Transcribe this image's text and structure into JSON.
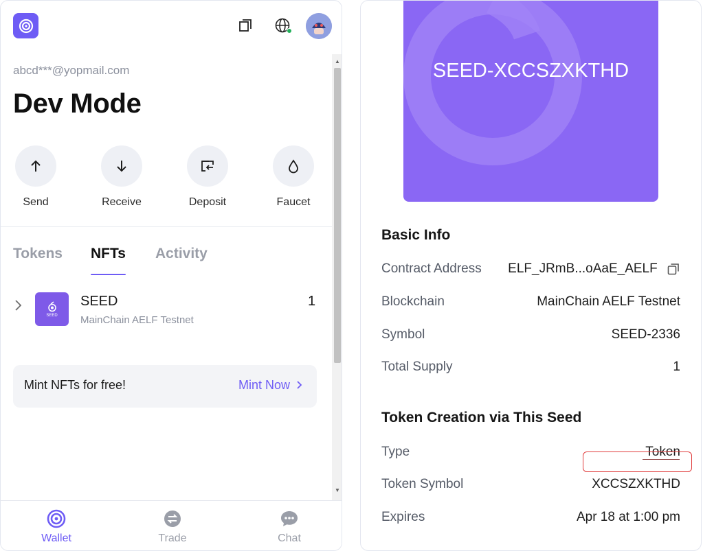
{
  "wallet": {
    "email": "abcd***@yopmail.com",
    "title": "Dev Mode",
    "actions": [
      {
        "label": "Send",
        "icon": "arrow-up-icon"
      },
      {
        "label": "Receive",
        "icon": "arrow-down-icon"
      },
      {
        "label": "Deposit",
        "icon": "deposit-icon"
      },
      {
        "label": "Faucet",
        "icon": "drop-icon"
      }
    ],
    "tabs": [
      {
        "label": "Tokens",
        "active": false
      },
      {
        "label": "NFTs",
        "active": true
      },
      {
        "label": "Activity",
        "active": false
      }
    ],
    "nft_item": {
      "name": "SEED",
      "chain": "MainChain AELF Testnet",
      "count": "1",
      "thumb_text": "SEED"
    },
    "mint": {
      "text": "Mint NFTs for free!",
      "link": "Mint Now"
    },
    "nav": [
      {
        "label": "Wallet",
        "active": true
      },
      {
        "label": "Trade",
        "active": false
      },
      {
        "label": "Chat",
        "active": false
      }
    ],
    "accent": "#6E5CF5"
  },
  "detail": {
    "hero_title": "SEED-XCCSZXKTHD",
    "hero_color": "#8A67F4",
    "basic_info": {
      "heading": "Basic Info",
      "rows": [
        {
          "label": "Contract Address",
          "value": "ELF_JRmB...oAaE_AELF"
        },
        {
          "label": "Blockchain",
          "value": "MainChain AELF Testnet"
        },
        {
          "label": "Symbol",
          "value": "SEED-2336"
        },
        {
          "label": "Total Supply",
          "value": "1"
        }
      ]
    },
    "token_creation": {
      "heading": "Token Creation via This Seed",
      "rows": [
        {
          "label": "Type",
          "value": "Token"
        },
        {
          "label": "Token Symbol",
          "value": "XCCSZXKTHD"
        },
        {
          "label": "Expires",
          "value": "Apr 18 at 1:00 pm"
        }
      ]
    }
  }
}
